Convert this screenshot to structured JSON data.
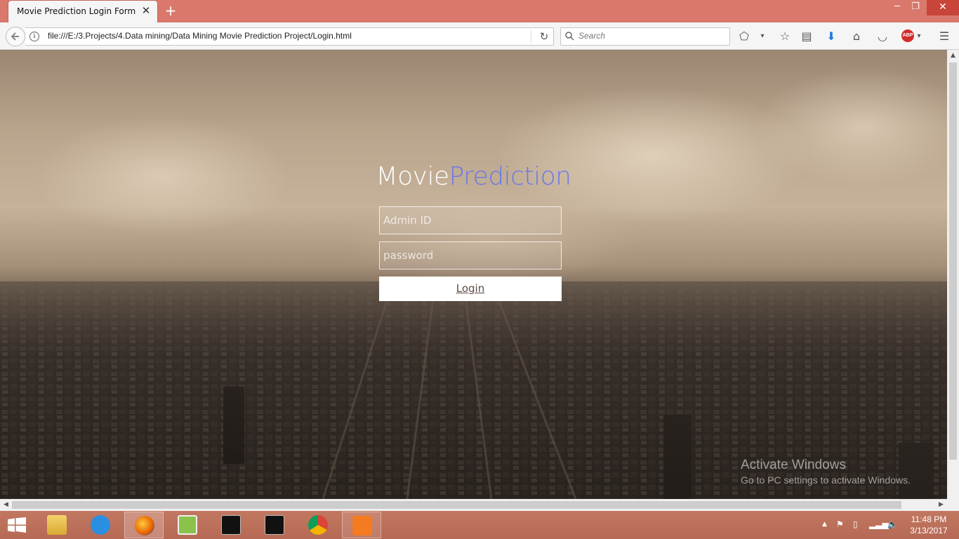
{
  "browser": {
    "tab_title": "Movie Prediction Login Form",
    "url": "file:///E:/3.Projects/4.Data mining/Data Mining Movie Prediction Project/Login.html",
    "search_placeholder": "Search"
  },
  "page": {
    "title_part1": "Movie",
    "title_part2": "Prediction",
    "title_color1": "#ffffff",
    "title_color2": "#6b78e8",
    "admin_placeholder": "Admin ID",
    "password_placeholder": "password",
    "login_label": "Login"
  },
  "watermark": {
    "line1": "Activate Windows",
    "line2": "Go to PC settings to activate Windows."
  },
  "taskbar": {
    "apps": [
      {
        "name": "file-explorer",
        "active": false
      },
      {
        "name": "sync-app",
        "active": false
      },
      {
        "name": "firefox",
        "active": true
      },
      {
        "name": "notepad-plus-plus",
        "active": false
      },
      {
        "name": "command-prompt",
        "active": false
      },
      {
        "name": "command-prompt",
        "active": false
      },
      {
        "name": "chrome",
        "active": false
      },
      {
        "name": "presentation-app",
        "active": false
      }
    ],
    "time": "11:48 PM",
    "date": "3/13/2017"
  }
}
